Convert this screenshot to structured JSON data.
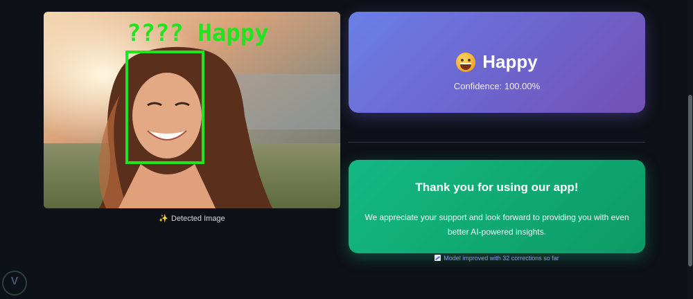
{
  "detection": {
    "overlay_label": "???? Happy",
    "caption_icon": "sparkles-icon",
    "caption": "Detected Image",
    "box_color": "#1ee51e"
  },
  "result": {
    "emoji_icon": "grinning-face-icon",
    "emotion": "Happy",
    "confidence": "Confidence: 100.00%"
  },
  "thanks": {
    "title": "Thank you for using our app!",
    "body": "We appreciate your support and look forward to providing you with even better AI-powered insights."
  },
  "model_note": {
    "icon": "chart-increasing-icon",
    "text": "Model improved with 32 corrections so far"
  },
  "colors": {
    "background": "#0e1117",
    "emotion_card": "#6d66cf",
    "thanks_card": "#10a872",
    "note_text": "#8c9bf0"
  }
}
